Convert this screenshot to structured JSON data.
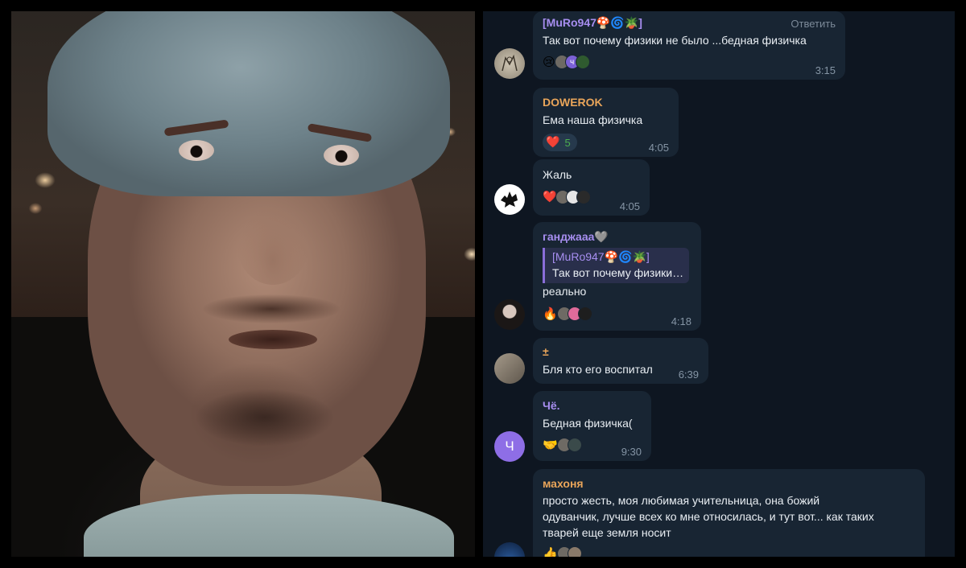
{
  "colors": {
    "chat_bg": "#0e1621",
    "bubble_bg": "#182533",
    "name_purple": "#a78ef0",
    "name_orange": "#e9a55a",
    "time_gray": "#8595a5",
    "heart_red": "#e53935",
    "count_green": "#4caf50"
  },
  "messages": [
    {
      "author": "[MuRo947🍄🌀🪴]",
      "text": "Так вот почему физики не было ...бедная физичка",
      "reply_label": "Ответить",
      "reactions": [
        "😢"
      ],
      "time": "3:15",
      "avatar": "sketch-avatar"
    },
    {
      "author": "DOWEROK",
      "text": "Ема наша физичка",
      "reaction_emoji": "❤️",
      "reaction_count": "5",
      "time": "4:05"
    },
    {
      "text": "Жаль",
      "reaction_emoji": "❤️",
      "time": "4:05",
      "avatar": "black-splash-avatar"
    },
    {
      "author": "ганджааа🩶",
      "quote_author": "[MuRo947🍄🌀🪴]",
      "quote_text": "Так вот почему физики не было ...бедная физичка",
      "text": "реально",
      "reaction_emoji": "🔥",
      "time": "4:18",
      "avatar": "girl-avatar"
    },
    {
      "author": "±",
      "text": "Бля кто его воспитал",
      "time": "6:39",
      "avatar": "room-avatar"
    },
    {
      "author": "Чё.",
      "text": "Бедная физичка(",
      "reaction_emoji": "🤝",
      "time": "9:30",
      "avatar_letter": "Ч"
    },
    {
      "author": "махоня",
      "lines": [
        "просто жесть, моя любимая учительница, она божий",
        "одуванчик, лучше всех ко мне относилась, и тут вот... как таких",
        "тварей еще земля носит"
      ],
      "reaction_emoji": "👍",
      "avatar": "night-avatar"
    }
  ],
  "mini_avatars": {
    "m1_letter": "ч"
  }
}
